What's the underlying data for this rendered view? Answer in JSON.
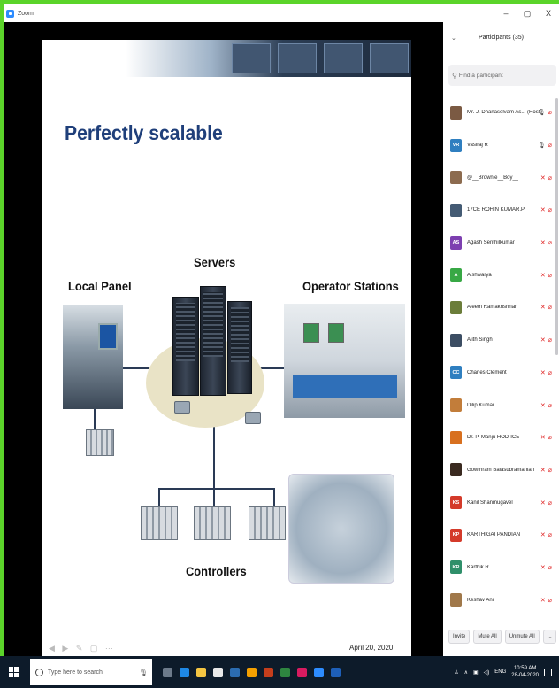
{
  "window": {
    "title": "Zoom",
    "controls": [
      "–",
      "▢",
      "X"
    ]
  },
  "slide": {
    "title": "Perfectly scalable",
    "labels": {
      "servers": "Servers",
      "local_panel": "Local Panel",
      "operator_stations": "Operator Stations",
      "controllers": "Controllers"
    },
    "date": "April 20, 2020"
  },
  "participants": {
    "header": "Participants (35)",
    "search_placeholder": "Find a participant",
    "list": [
      {
        "name": "Mr. J. Dhanaselvam As... (Host, me)",
        "initials": "",
        "color": "#7b5a43",
        "mic": "on"
      },
      {
        "name": "Vasiraj R",
        "initials": "VR",
        "color": "#2f7fc0",
        "mic": "on"
      },
      {
        "name": "@__Brownie__Boy__",
        "initials": "",
        "color": "#8c6b4f",
        "mic": "off"
      },
      {
        "name": "17CE ROHIN KUMAR.P",
        "initials": "",
        "color": "#445b74",
        "mic": "off"
      },
      {
        "name": "Agash Senthilkumar",
        "initials": "AS",
        "color": "#7d3fb0",
        "mic": "off"
      },
      {
        "name": "Aishwarya",
        "initials": "A",
        "color": "#38a845",
        "mic": "off"
      },
      {
        "name": "Ajeeth Ramakrishnan",
        "initials": "",
        "color": "#6b7d3a",
        "mic": "off"
      },
      {
        "name": "Ajith Singh",
        "initials": "",
        "color": "#3c4d63",
        "mic": "off"
      },
      {
        "name": "Charles Clement",
        "initials": "CC",
        "color": "#2f7fc0",
        "mic": "off"
      },
      {
        "name": "Dilip Kumar",
        "initials": "",
        "color": "#c27d3a",
        "mic": "off"
      },
      {
        "name": "Dr. P. Manju HOD-ICE",
        "initials": "",
        "color": "#d8701f",
        "mic": "off"
      },
      {
        "name": "Gowthram Balasubramanian",
        "initials": "",
        "color": "#3a2a20",
        "mic": "off"
      },
      {
        "name": "Kanil Shanmugavel",
        "initials": "KS",
        "color": "#d43a2a",
        "mic": "off"
      },
      {
        "name": "KARTHIGAI PANDIAN",
        "initials": "KP",
        "color": "#d43a2a",
        "mic": "off"
      },
      {
        "name": "Karthik R",
        "initials": "KR",
        "color": "#2f8f6a",
        "mic": "off"
      },
      {
        "name": "Keshav Anil",
        "initials": "",
        "color": "#a0784a",
        "mic": "off"
      }
    ],
    "buttons": {
      "invite": "Invite",
      "mute_all": "Mute All",
      "unmute_all": "Unmute All",
      "more": "..."
    }
  },
  "taskbar": {
    "search_placeholder": "Type here to search",
    "language": "ENG",
    "time": "10:59 AM",
    "date": "28-04-2020"
  }
}
